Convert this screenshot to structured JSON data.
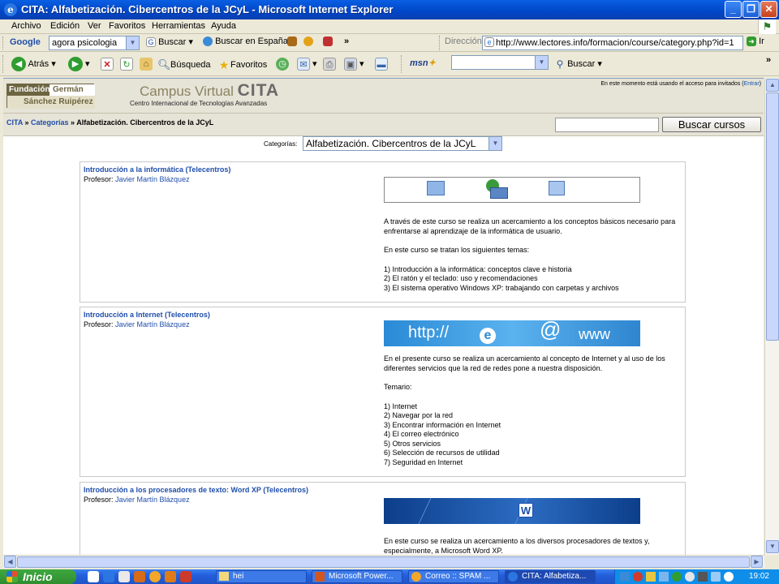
{
  "window": {
    "title": "CITA: Alfabetización. Cibercentros de la JCyL - Microsoft Internet Explorer"
  },
  "menu": [
    "Archivo",
    "Edición",
    "Ver",
    "Favoritos",
    "Herramientas",
    "Ayuda"
  ],
  "google_bar": {
    "logo": "Google",
    "query": "agora psicologia",
    "search_label": "Buscar",
    "spain_label": "Buscar en España",
    "more": "»",
    "address_label": "Dirección",
    "address": "http://www.lectores.info/formacion/course/category.php?id=1",
    "go_label": "Ir"
  },
  "std_toolbar": {
    "back": "Atrás",
    "search": "Búsqueda",
    "favorites": "Favoritos",
    "msn": "msn",
    "msn_search": "Buscar"
  },
  "page": {
    "logo": {
      "l1": "Fundación",
      "l2": "Germán",
      "l3": "Sánchez Ruipérez"
    },
    "campus_prefix": "Campus Virtual",
    "campus_name": "CITA",
    "campus_sub": "Centro Internacional de Tecnologías Avanzadas",
    "login_text": "En este momento está usando el acceso para invitados (",
    "login_link": "Entrar",
    "login_close": ")",
    "crumb": {
      "home": "CITA",
      "sep1": " » ",
      "cats": "Categorías",
      "sep2": " » ",
      "current": "Alfabetización. Cibercentros de la JCyL"
    },
    "search_button": "Buscar cursos",
    "categories_label": "Categorías:",
    "category_selected": "Alfabetización. Cibercentros de la JCyL"
  },
  "courses": [
    {
      "title": "Introducción a la informática (Telecentros)",
      "teacher_label": "Profesor:",
      "teacher": "Javier Martín Blázquez",
      "paras": [
        "A través de este curso se realiza un acercamiento a los conceptos básicos necesario para enfrentarse al aprendizaje de la informática de usuario.",
        "En este curso se tratan los siguientes temas:",
        "1) Introducción a la informática: conceptos clave e historia",
        "2) El ratón y el teclado: uso y recomendaciones",
        "3) El sistema operativo Windows XP: trabajando con carpetas y archivos"
      ]
    },
    {
      "title": "Introducción a Internet (Telecentros)",
      "teacher_label": "Profesor:",
      "teacher": "Javier Martín Blázquez",
      "banner": {
        "http": "http://",
        "at": "@",
        "www": "www"
      },
      "paras": [
        "En el presente curso se realiza un acercamiento al concepto de Internet y al uso de los diferentes servicios que la red de redes pone a nuestra disposición.",
        "Temario:",
        "1) Internet",
        "2) Navegar por la red",
        "3) Encontrar información en Internet",
        "4) El correo electrónico",
        "5) Otros servicios",
        "6) Selección de recursos de utilidad",
        "7) Seguridad en Internet"
      ]
    },
    {
      "title": "Introducción a los procesadores de texto: Word XP (Telecentros)",
      "teacher_label": "Profesor:",
      "teacher": "Javier Martín Blázquez",
      "banner": {
        "w": "W"
      },
      "paras": [
        "En este curso se realiza un acercamiento a los diversos procesadores de textos y, especialmente, a Microsoft Word XP."
      ]
    }
  ],
  "taskbar": {
    "start": "Inicio",
    "buttons": [
      "hei",
      "Microsoft Power...",
      "Correo :: SPAM ...",
      "CITA: Alfabetiza..."
    ],
    "clock": "19:02"
  }
}
